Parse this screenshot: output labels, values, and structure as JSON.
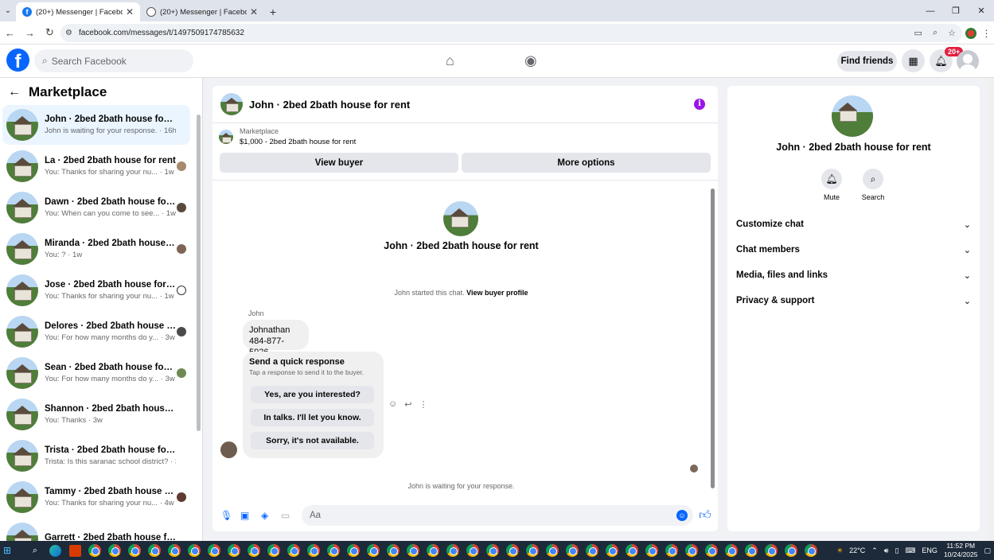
{
  "browser": {
    "tabs": [
      {
        "title": "(20+) Messenger | Facebook",
        "active": true
      },
      {
        "title": "(20+) Messenger | Facebook",
        "active": false
      }
    ],
    "url": "facebook.com/messages/t/1497509174785632"
  },
  "header": {
    "search_placeholder": "Search Facebook",
    "find_friends": "Find friends",
    "notification_badge": "20+"
  },
  "left": {
    "title": "Marketplace",
    "conversations": [
      {
        "name": "John · 2bed 2bath house for rent",
        "preview": "John is waiting for your response. · 16h",
        "active": true
      },
      {
        "name": "La · 2bed 2bath house for rent",
        "preview": "You: Thanks for sharing your nu... · 1w"
      },
      {
        "name": "Dawn · 2bed 2bath house for ...",
        "preview": "You: When can you come to see... · 1w"
      },
      {
        "name": "Miranda · 2bed 2bath house f...",
        "preview": "You: ? · 1w"
      },
      {
        "name": "Jose · 2bed 2bath house for re...",
        "preview": "You: Thanks for sharing your nu... · 1w"
      },
      {
        "name": "Delores · 2bed 2bath house fo...",
        "preview": "You: For how many months do y... · 3w"
      },
      {
        "name": "Sean · 2bed 2bath house for r...",
        "preview": "You: For how many months do y... · 3w"
      },
      {
        "name": "Shannon · 2bed 2bath house for...",
        "preview": "You: Thanks · 3w"
      },
      {
        "name": "Trista · 2bed 2bath house for rent",
        "preview": "Trista: Is this saranac school district? · 3w"
      },
      {
        "name": "Tammy · 2bed 2bath house fo...",
        "preview": "You: Thanks for sharing your nu... · 4w"
      },
      {
        "name": "Garrett · 2bed 2bath house for r...",
        "preview": ""
      }
    ]
  },
  "chat": {
    "title": "John · 2bed 2bath house for rent",
    "marketplace_label": "Marketplace",
    "listing": "$1,000 - 2bed 2bath house for rent",
    "view_buyer": "View buyer",
    "more_options": "More options",
    "center_name": "John · 2bed 2bath house for rent",
    "started_text": "John started this chat.",
    "view_buyer_profile": "View buyer profile",
    "sender": "John",
    "message_line1": "Johnathan",
    "message_line2": "484-877-5926",
    "quick_title": "Send a quick response",
    "quick_sub": "Tap a response to send it to the buyer.",
    "quick_options": [
      "Yes, are you interested?",
      "In talks. I'll let you know.",
      "Sorry, it's not available."
    ],
    "waiting": "John is waiting for your response.",
    "composer_placeholder": "Aa"
  },
  "right": {
    "name": "John · 2bed 2bath house for rent",
    "mute": "Mute",
    "search": "Search",
    "sections": [
      "Customize chat",
      "Chat members",
      "Media, files and links",
      "Privacy & support"
    ]
  },
  "taskbar": {
    "weather": "22°C",
    "lang": "ENG",
    "time": "11:52 PM",
    "date": "10/24/2025"
  },
  "colors": {
    "fb_blue": "#0866ff",
    "active_conv": "#ebf5ff",
    "badge_red": "#e41e3f",
    "info_purple": "#9b16e8"
  }
}
